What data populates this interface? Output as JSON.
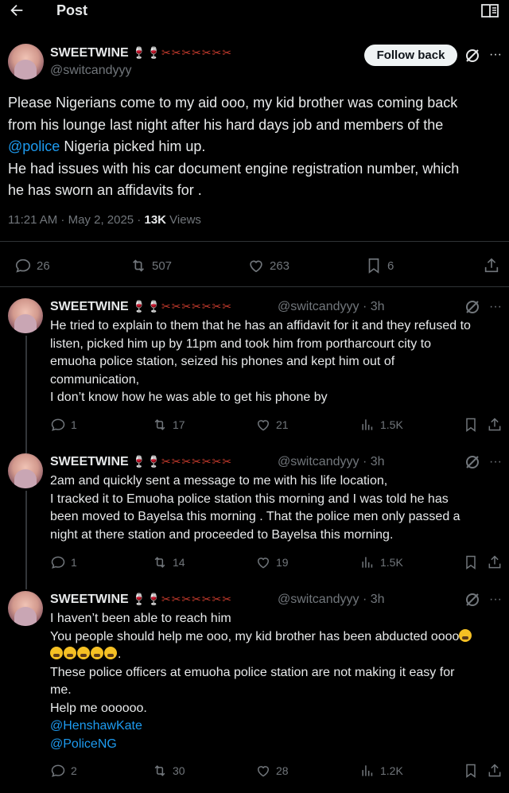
{
  "header": {
    "title": "Post"
  },
  "colors": {
    "background": "#000000",
    "text": "#e7e9ea",
    "muted": "#71767b",
    "link": "#1d9bf0",
    "divider": "#2f3336"
  },
  "icons": [
    "back-arrow-icon",
    "reader-mode-icon",
    "grok-icon",
    "more-icon",
    "reply-icon",
    "repost-icon",
    "like-icon",
    "bookmark-icon",
    "share-icon",
    "views-icon"
  ],
  "main_post": {
    "author_name": "SWEETWINE",
    "author_emojis": "🍷🍷✂✂✂✂✂✂✂",
    "handle": "@switcandyyy",
    "follow_label": "Follow back",
    "more": "···",
    "text_lines": [
      "Please Nigerians come to my aid ooo, my kid brother was coming back",
      "from his lounge last night after his hard days job and members of the",
      "Nigeria picked him up.",
      "He had issues with his car document engine registration number, which",
      "he has sworn an affidavits for ."
    ],
    "mention": "@police",
    "time": "11:21 AM · May 2, 2025 · ",
    "views_count": "13K",
    "views_label": " Views",
    "stats": {
      "replies": "26",
      "reposts": "507",
      "likes": "263",
      "bookmarks": "6"
    }
  },
  "replies": [
    {
      "author_name": "SWEETWINE",
      "author_emojis": "🍷🍷✂✂✂✂✂✂✂",
      "handle_time": "@switcandyyy · 3h",
      "more": "···",
      "text_lines": [
        "He tried to explain to them that he has an affidavit for it and they refused to",
        "listen, picked him up by 11pm and took him from portharcourt city to",
        "emuoha police station, seized his phones and kept him out of",
        "communication,",
        "I don’t know how he was able to get his phone by"
      ],
      "stats": {
        "replies": "1",
        "reposts": "17",
        "likes": "21",
        "views": "1.5K"
      }
    },
    {
      "author_name": "SWEETWINE",
      "author_emojis": "🍷🍷✂✂✂✂✂✂✂",
      "handle_time": "@switcandyyy · 3h",
      "more": "···",
      "text_lines": [
        "2am and quickly sent a message to me with his life location,",
        "I tracked it to Emuoha police station this morning and I was told he has",
        "been moved to Bayelsa this morning . That the police men only passed a",
        "night at there station and proceeded to Bayelsa this morning."
      ],
      "stats": {
        "replies": "1",
        "reposts": "14",
        "likes": "19",
        "views": "1.5K"
      }
    },
    {
      "author_name": "SWEETWINE",
      "author_emojis": "🍷🍷✂✂✂✂✂✂✂",
      "handle_time": "@switcandyyy · 3h",
      "more": "···",
      "text_lines": [
        "I haven’t been able to reach him",
        "You people should help me ooo, my kid brother has been abducted oooo",
        ".",
        "These police officers at emuoha police station are not making it easy for",
        "me.",
        "Help me oooooo."
      ],
      "mentions": [
        "@HenshawKate",
        "@PoliceNG"
      ],
      "stats": {
        "replies": "2",
        "reposts": "30",
        "likes": "28",
        "views": "1.2K"
      }
    }
  ]
}
